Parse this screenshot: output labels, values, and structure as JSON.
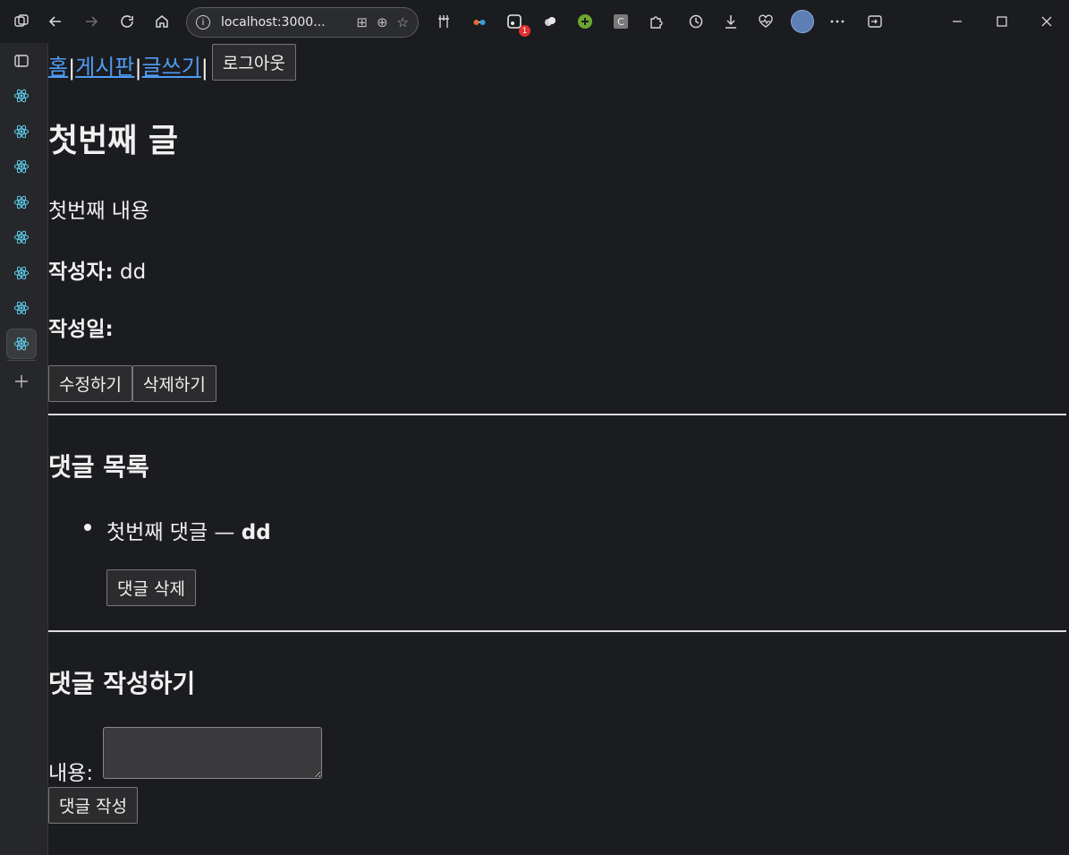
{
  "browser": {
    "url": "localhost:3000...",
    "tabs_count": 8
  },
  "nav": {
    "home": "홈",
    "board": "게시판",
    "write": "글쓰기",
    "sep1": " |",
    "sep2": " |",
    "sep3": " |",
    "logout": "로그아웃"
  },
  "post": {
    "title": "첫번째 글",
    "content": "첫번째 내용",
    "author_label": "작성자:",
    "author": "dd",
    "date_label": "작성일:",
    "date": "",
    "edit_button": "수정하기",
    "delete_button": "삭제하기"
  },
  "comments": {
    "heading": "댓글 목록",
    "items": [
      {
        "text": "첫번째 댓글 — ",
        "author": "dd",
        "delete_button": "댓글 삭제"
      }
    ]
  },
  "comment_form": {
    "heading": "댓글 작성하기",
    "content_label": "내용:",
    "content_value": "",
    "submit_button": "댓글 작성"
  },
  "colors": {
    "link": "#4e9bf2",
    "background": "#1b1c1f",
    "text": "#f0f0f0"
  }
}
